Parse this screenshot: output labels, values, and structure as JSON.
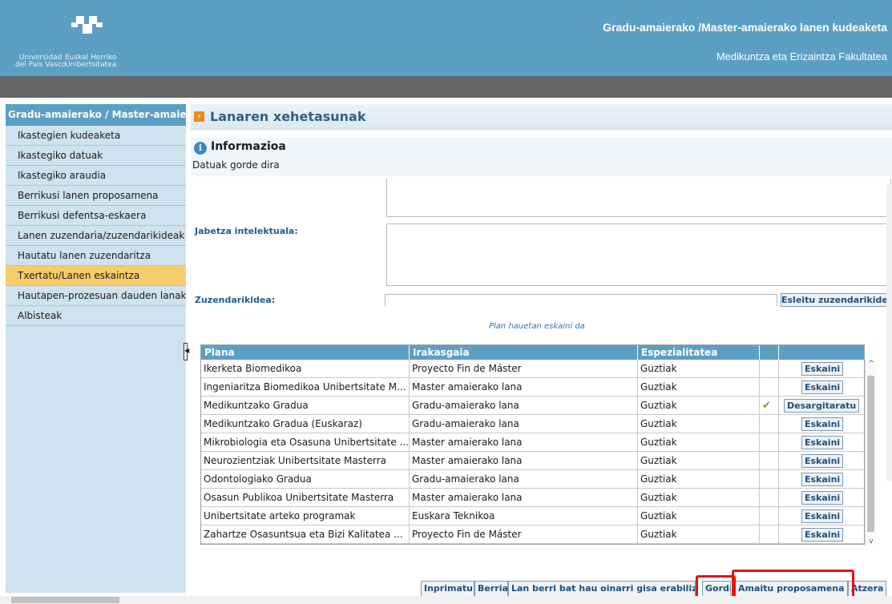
{
  "header": {
    "app_title": "Gradu-amaierako /Master-amaierako lanen kudeaketa",
    "faculty": "Medikuntza eta Erizaintza Fakultatea",
    "logo_left": "Universidad\ndel País Vasco",
    "logo_right": "Euskal Herriko\nUnibertsitatea"
  },
  "sidebar": {
    "title": "Gradu-amaierako / Master-amaierako",
    "items": [
      {
        "label": "Ikastegien kudeaketa",
        "active": false
      },
      {
        "label": "Ikastegiko datuak",
        "active": false
      },
      {
        "label": "Ikastegiko araudia",
        "active": false
      },
      {
        "label": "Berrikusi lanen proposamena",
        "active": false
      },
      {
        "label": "Berrikusi defentsa-eskaera",
        "active": false
      },
      {
        "label": "Lanen zuzendaria/zuzendarikideak",
        "active": false
      },
      {
        "label": "Hautatu lanen zuzendaritza",
        "active": false
      },
      {
        "label": "Txertatu/Lanen eskaintza",
        "active": true
      },
      {
        "label": "Hautapen-prozesuan dauden lanak",
        "active": false
      },
      {
        "label": "Albisteak",
        "active": false
      }
    ]
  },
  "main": {
    "section_title": "Lanaren xehetasunak",
    "info_title": "Informazioa",
    "info_message": "Datuak gorde dira",
    "intellectual_property_label": "Jabetza intelektuala:",
    "codirector_label": "Zuzendarikidea:",
    "assign_codirector_button": "Esleitu zuzendarikidea",
    "offered_caption": "Plan hauetan eskaini da"
  },
  "grid": {
    "headers": [
      "Plana",
      "Irakasgaia",
      "Espezialitatea",
      "",
      ""
    ],
    "rows": [
      {
        "plan": "Ikerketa Biomedikoa",
        "subject": "Proyecto Fin de Máster",
        "spec": "Guztiak",
        "checked": false,
        "action": "Eskaini"
      },
      {
        "plan": "Ingeniaritza Biomedikoa Unibertsitate M...",
        "subject": "Master amaierako lana",
        "spec": "Guztiak",
        "checked": false,
        "action": "Eskaini"
      },
      {
        "plan": "Medikuntzako Gradua",
        "subject": "Gradu-amaierako lana",
        "spec": "Guztiak",
        "checked": true,
        "action": "Desargitaratu"
      },
      {
        "plan": "Medikuntzako Gradua (Euskaraz)",
        "subject": "Gradu-amaierako lana",
        "spec": "Guztiak",
        "checked": false,
        "action": "Eskaini"
      },
      {
        "plan": "Mikrobiologia eta Osasuna Unibertsitate ...",
        "subject": "Master amaierako lana",
        "spec": "Guztiak",
        "checked": false,
        "action": "Eskaini"
      },
      {
        "plan": "Neurozientziak Unibertsitate Masterra",
        "subject": "Master amaierako lana",
        "spec": "Guztiak",
        "checked": false,
        "action": "Eskaini"
      },
      {
        "plan": "Odontologiako Gradua",
        "subject": "Gradu-amaierako lana",
        "spec": "Guztiak",
        "checked": false,
        "action": "Eskaini"
      },
      {
        "plan": "Osasun Publikoa Unibertsitate Masterra",
        "subject": "Master amaierako lana",
        "spec": "Guztiak",
        "checked": false,
        "action": "Eskaini"
      },
      {
        "plan": "Unibertsitate arteko programak",
        "subject": "Euskara Teknikoa",
        "spec": "Guztiak",
        "checked": false,
        "action": "Eskaini"
      },
      {
        "plan": "Zahartze Osasuntsua eta Bizi Kalitatea ...",
        "subject": "Proyecto Fin de Máster",
        "spec": "Guztiak",
        "checked": false,
        "action": "Eskaini"
      }
    ]
  },
  "toolbar": {
    "print": "Inprimatu",
    "new": "Berria",
    "new_based": "Lan berri bat hau oinarri gisa erabiliz",
    "save": "Gorde",
    "finish_proposal": "Amaitu proposamena",
    "back": "Atzera"
  },
  "colors": {
    "header_blue": "#5c9fc5",
    "active_item": "#f6cd6b",
    "highlight_red": "#e5120d"
  }
}
